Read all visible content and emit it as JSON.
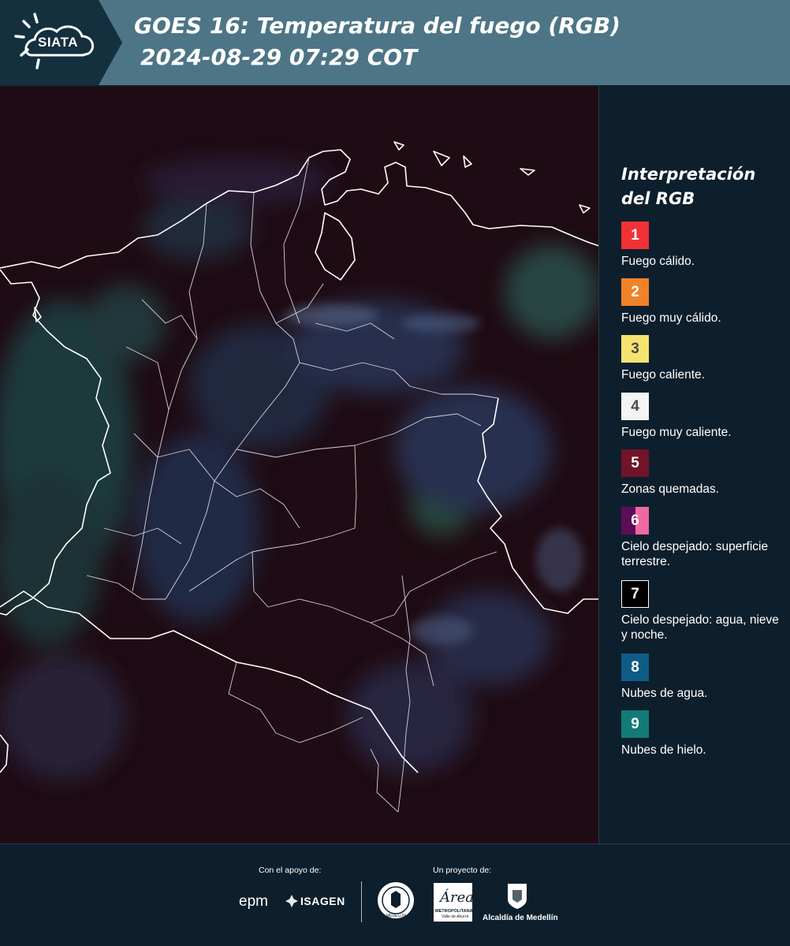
{
  "header": {
    "logo_text": "SIATA",
    "title_line1": "GOES 16: Temperatura del fuego (RGB)",
    "title_line2": "2024-08-29 07:29 COT"
  },
  "legend": {
    "title": "Interpretación del RGB",
    "items": [
      {
        "number": "1",
        "label": "Fuego cálido.",
        "color": "#f03237"
      },
      {
        "number": "2",
        "label": "Fuego muy cálido.",
        "color": "#f0822a"
      },
      {
        "number": "3",
        "label": "Fuego caliente.",
        "color": "#f6e36f"
      },
      {
        "number": "4",
        "label": "Fuego muy caliente.",
        "color": "#f4f4f4"
      },
      {
        "number": "5",
        "label": "Zonas quemadas.",
        "color": "#73132a"
      },
      {
        "number": "6",
        "label": "Cielo despejado: superficie terrestre.",
        "color": "#5c0d58",
        "color2": "#ef69a1"
      },
      {
        "number": "7",
        "label": "Cielo despejado: agua, nieve y noche.",
        "color": "#000000"
      },
      {
        "number": "8",
        "label": "Nubes de agua.",
        "color": "#0e5c86"
      },
      {
        "number": "9",
        "label": "Nubes de hielo.",
        "color": "#127a77"
      }
    ]
  },
  "footer": {
    "support_label": "Con el apoyo de:",
    "project_label": "Un proyecto de:",
    "epm": "epm",
    "isagen": "ISAGEN",
    "metro_title": "Área",
    "metro_sub1": "METROPOLITANA",
    "metro_sub2": "Valle de Aburrá",
    "alcaldia": "Alcaldía de Medellín",
    "seal_label": "MEDELLÍN"
  }
}
